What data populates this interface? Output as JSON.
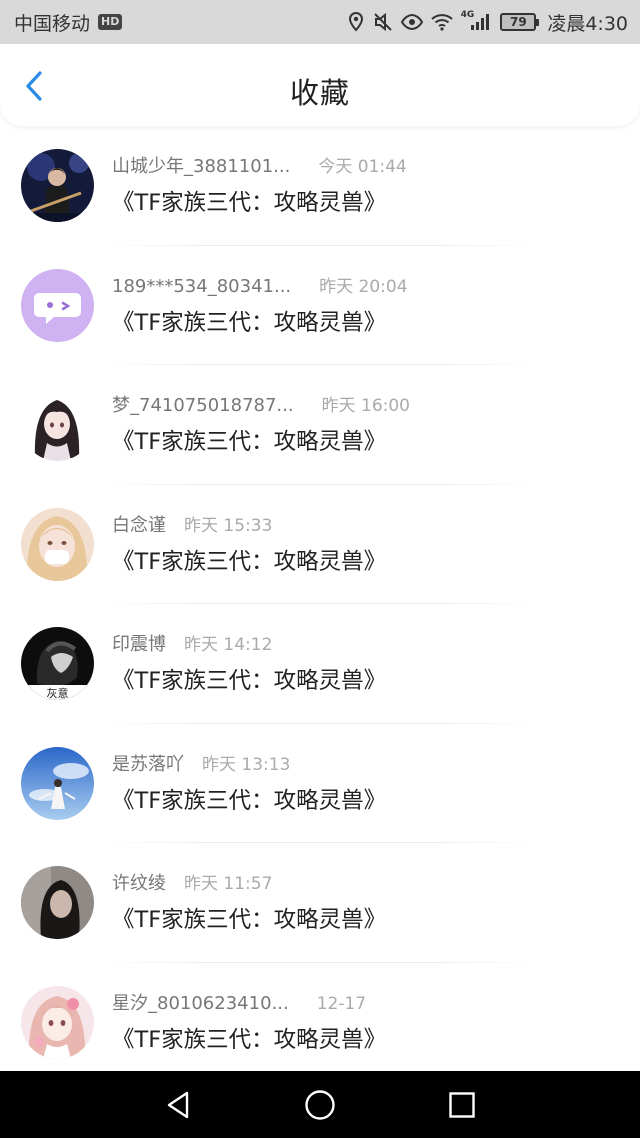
{
  "status_bar": {
    "carrier": "中国移动",
    "hd_badge": "HD",
    "network_label": "4G",
    "battery": "79",
    "time": "凌晨4:30",
    "icons": [
      "location-icon",
      "mute-icon",
      "eye-icon",
      "wifi-icon",
      "signal-icon",
      "battery-icon"
    ]
  },
  "header": {
    "title": "收藏",
    "back_icon": "chevron-left-icon",
    "accent_color": "#2b8ae8"
  },
  "favorites": [
    {
      "user": "山城少年_3881101...",
      "time": "今天 01:44",
      "book": "《TF家族三代：攻略灵兽》",
      "avatar": "avatar-performer"
    },
    {
      "user": "189***534_80341...",
      "time": "昨天 20:04",
      "book": "《TF家族三代：攻略灵兽》",
      "avatar": "avatar-default-chat"
    },
    {
      "user": "梦_741075018787...",
      "time": "昨天 16:00",
      "book": "《TF家族三代：攻略灵兽》",
      "avatar": "avatar-anime-girl"
    },
    {
      "user": "白念谨",
      "time": "昨天 15:33",
      "book": "《TF家族三代：攻略灵兽》",
      "avatar": "avatar-photo"
    },
    {
      "user": "印震博",
      "time": "昨天 14:12",
      "book": "《TF家族三代：攻略灵兽》",
      "avatar": "avatar-dark"
    },
    {
      "user": "是苏落吖",
      "time": "昨天 13:13",
      "book": "《TF家族三代：攻略灵兽》",
      "avatar": "avatar-sky"
    },
    {
      "user": "许纹绫",
      "time": "昨天 11:57",
      "book": "《TF家族三代：攻略灵兽》",
      "avatar": "avatar-portrait"
    },
    {
      "user": "星汐_8010623410...",
      "time": "12-17",
      "book": "《TF家族三代：攻略灵兽》",
      "avatar": "avatar-anime-pink"
    }
  ],
  "avatar_text": {
    "dark": "灰意"
  },
  "nav_bar": {
    "icons": [
      "back-triangle-icon",
      "home-circle-icon",
      "recents-square-icon"
    ]
  }
}
